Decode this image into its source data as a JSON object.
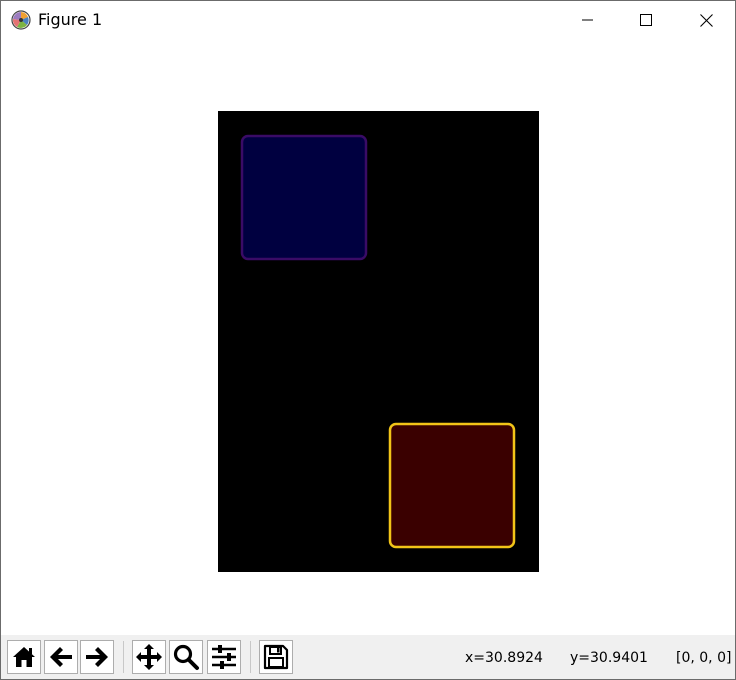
{
  "window": {
    "title": "Figure 1",
    "controls": {
      "minimize_icon": "minimize-icon",
      "maximize_icon": "maximize-icon",
      "close_icon": "close-icon"
    }
  },
  "figure": {
    "background": "#000000",
    "squares": [
      {
        "name": "blue-square",
        "fill": "#000040",
        "edge": "#3a0b66"
      },
      {
        "name": "red-square",
        "fill": "#3a0000",
        "edge": "#f2c418"
      }
    ]
  },
  "toolbar": {
    "buttons": [
      {
        "name": "home-button",
        "icon": "home-icon"
      },
      {
        "name": "back-button",
        "icon": "arrow-left-icon"
      },
      {
        "name": "forward-button",
        "icon": "arrow-right-icon"
      },
      {
        "name": "pan-button",
        "icon": "move-icon"
      },
      {
        "name": "zoom-button",
        "icon": "zoom-icon"
      },
      {
        "name": "configure-subplots-button",
        "icon": "sliders-icon"
      },
      {
        "name": "save-button",
        "icon": "save-icon"
      }
    ],
    "status": {
      "x": "x=30.8924",
      "y": "y=30.9401",
      "value": "[0, 0, 0]"
    }
  }
}
